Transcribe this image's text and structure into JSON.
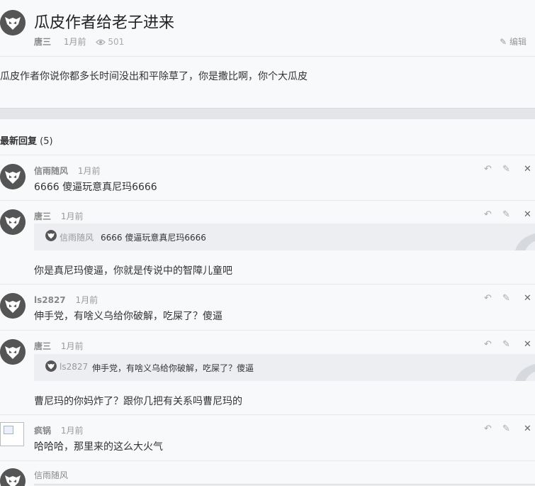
{
  "topic": {
    "title": "瓜皮作者给老子进来",
    "author": "唐三",
    "time": "1月前",
    "views": "501",
    "edit_label": "编辑",
    "body": "瓜皮作者你说你都多长时间没出和平除草了，你是撒比啊，你个大瓜皮"
  },
  "replies_header": {
    "label": "最新回复",
    "count": "(5)"
  },
  "replies": [
    {
      "name": "信雨随风",
      "time": "1月前",
      "text": "6666   傻逼玩意真尼玛6666"
    },
    {
      "name": "唐三",
      "time": "1月前",
      "quote_name": "信雨随风",
      "quote_text": "6666 傻逼玩意真尼玛6666",
      "text": "你是真尼玛傻逼，你就是传说中的智障儿童吧"
    },
    {
      "name": "ls2827",
      "time": "1月前",
      "text": "伸手党，有啥义乌给你破解，吃屎了？傻逼"
    },
    {
      "name": "唐三",
      "time": "1月前",
      "quote_name": "ls2827",
      "quote_text": "伸手党，有啥义乌给你破解，吃屎了？傻逼",
      "text": "曹尼玛的你妈炸了？跟你几把有关系吗曹尼玛的"
    },
    {
      "name": "疯锅",
      "time": "1月前",
      "text": "哈哈哈，那里来的这么大火气"
    },
    {
      "name": "信雨随风",
      "time": "",
      "text": ""
    }
  ],
  "icons": {
    "reply": "reply-icon",
    "edit": "edit-icon",
    "delete": "close-icon",
    "views": "eye-icon",
    "quote": "quote-mark-icon"
  }
}
